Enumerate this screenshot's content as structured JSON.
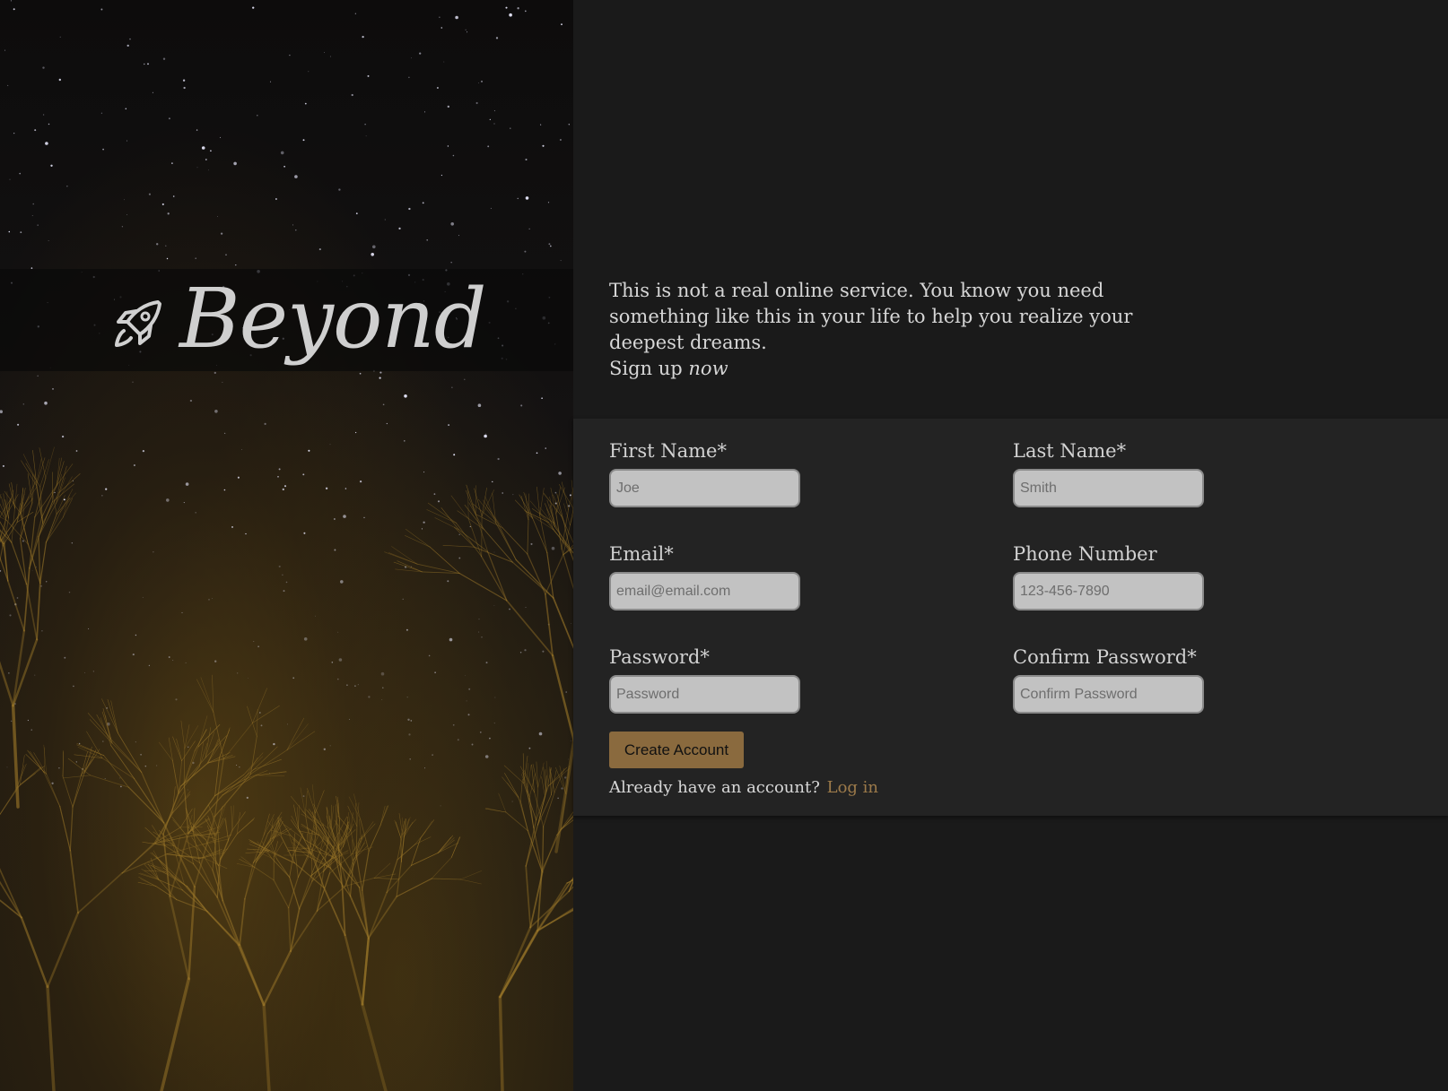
{
  "brand": {
    "name": "Beyond",
    "icon": "rocket-icon"
  },
  "intro": {
    "text": "This is not a real online service. You know you need something like this in your life to help you realize your deepest dreams.",
    "cta_prefix": "Sign up",
    "cta_emphasis": "now"
  },
  "form": {
    "first_name": {
      "label": "First Name*",
      "placeholder": "Joe"
    },
    "last_name": {
      "label": "Last Name*",
      "placeholder": "Smith"
    },
    "email": {
      "label": "Email*",
      "placeholder": "email@email.com"
    },
    "phone": {
      "label": "Phone Number",
      "placeholder": "123-456-7890"
    },
    "password": {
      "label": "Password*",
      "placeholder": "Password"
    },
    "confirm_password": {
      "label": "Confirm Password*",
      "placeholder": "Confirm Password"
    },
    "submit_label": "Create Account",
    "login_prompt": "Already have an account?",
    "login_link": "Log in"
  },
  "colors": {
    "accent": "#8a6a3e",
    "link": "#9c7a4a",
    "page_background": "#1a1a1a",
    "panel_background": "#232323"
  }
}
